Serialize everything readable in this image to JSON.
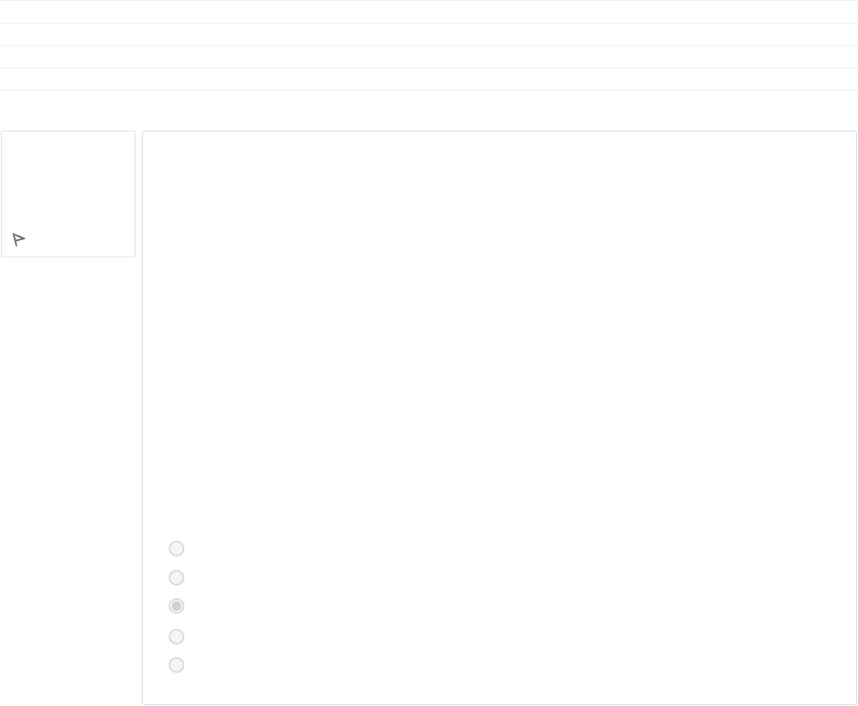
{
  "question": {
    "options": [
      {
        "selected": false
      },
      {
        "selected": false
      },
      {
        "selected": true
      },
      {
        "selected": false
      },
      {
        "selected": false
      }
    ]
  }
}
